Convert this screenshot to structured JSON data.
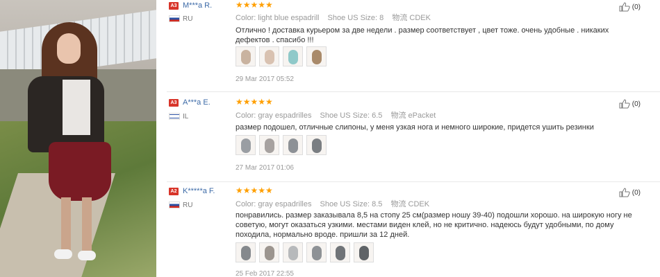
{
  "reviews": [
    {
      "level": "A3",
      "user": "M***a R.",
      "country": "RU",
      "stars": "★★★★★",
      "color_label": "Color:",
      "color": "light blue espadrill",
      "size_label": "Shoe US Size:",
      "size": "8",
      "ship_label": "物流",
      "ship": "CDEK",
      "text": "Отлично ! доставка курьером за две недели . размер соответствует , цвет тоже. очень удобные . никаких дефектов . спасибо !!!",
      "thumbs": [
        "#c9b3a0",
        "#d9c2b1",
        "#8fc9c9",
        "#a98a6a"
      ],
      "date": "29 Mar 2017 05:52",
      "helpful": "(0)"
    },
    {
      "level": "A3",
      "user": "A***a E.",
      "country": "IL",
      "stars": "★★★★★",
      "color_label": "Color:",
      "color": "gray espadrilles",
      "size_label": "Shoe US Size:",
      "size": "6.5",
      "ship_label": "物流",
      "ship": "ePacket",
      "text": "размер подошел, отличные слипоны, у меня узкая нога и немного широкие, придется ушить резинки",
      "thumbs": [
        "#9a9ea3",
        "#a7a2a0",
        "#8d9196",
        "#7a7e82"
      ],
      "date": "27 Mar 2017 01:06",
      "helpful": "(0)"
    },
    {
      "level": "A2",
      "user": "K*****a F.",
      "country": "RU",
      "stars": "★★★★★",
      "color_label": "Color:",
      "color": "gray espadrilles",
      "size_label": "Shoe US Size:",
      "size": "8.5",
      "ship_label": "物流",
      "ship": "CDEK",
      "text": "понравились. размер заказывала 8,5 на стопу 25 см(размер ношу 39-40) подошли хорошо. на широкую ногу не советую, могут оказаться узкими. местами виден клей, но не критично. надеюсь будут удобными, по дому походила, нормально вроде. пришли за 12 дней.",
      "thumbs": [
        "#85898d",
        "#9c958f",
        "#b7b9bb",
        "#8e9296",
        "#707478",
        "#5f6367"
      ],
      "date": "25 Feb 2017 22:55",
      "helpful": "(0)"
    }
  ]
}
